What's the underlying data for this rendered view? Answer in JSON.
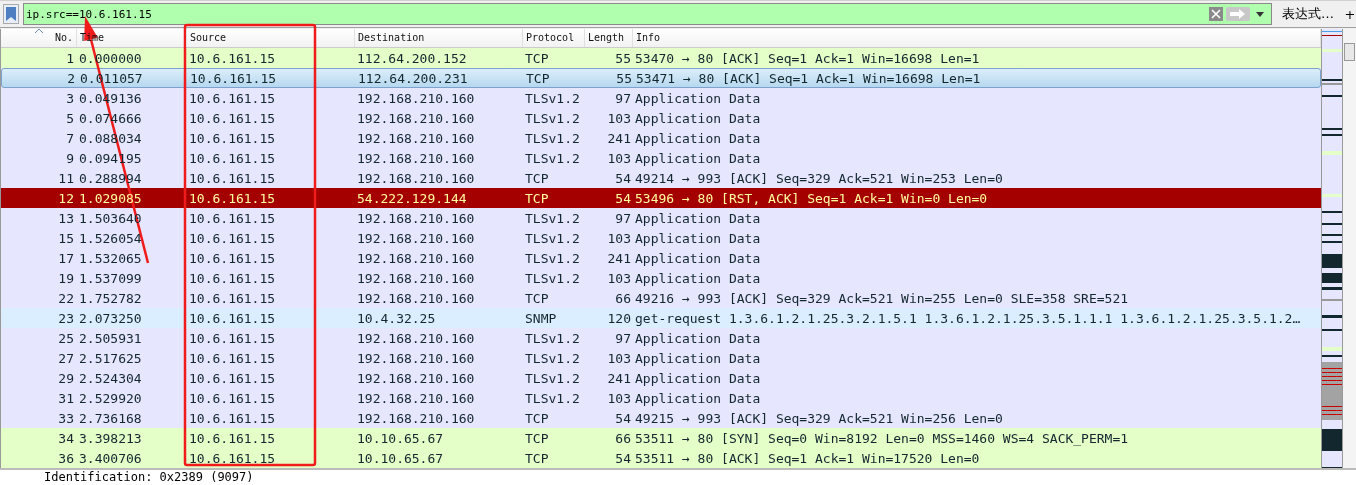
{
  "filter": {
    "value": "ip.src==10.6.161.15",
    "expression_button": "表达式…",
    "add_button": "+"
  },
  "columns": [
    {
      "label": "No.",
      "sorted": true
    },
    {
      "label": "Time",
      "sorted": false
    },
    {
      "label": "Source",
      "sorted": false
    },
    {
      "label": "Destination",
      "sorted": false
    },
    {
      "label": "Protocol",
      "sorted": false
    },
    {
      "label": "Length",
      "sorted": false
    },
    {
      "label": "Info",
      "sorted": false
    }
  ],
  "rows": [
    {
      "no": "1",
      "time": "0.000000",
      "source": "10.6.161.15",
      "destination": "112.64.200.152",
      "protocol": "TCP",
      "length": "55",
      "info": "53470 → 80 [ACK] Seq=1 Ack=1 Win=16698 Len=1",
      "color": "#e4ffc7",
      "selected": false
    },
    {
      "no": "2",
      "time": "0.011057",
      "source": "10.6.161.15",
      "destination": "112.64.200.231",
      "protocol": "TCP",
      "length": "55",
      "info": "53471 → 80 [ACK] Seq=1 Ack=1 Win=16698 Len=1",
      "selected": true
    },
    {
      "no": "3",
      "time": "0.049136",
      "source": "10.6.161.15",
      "destination": "192.168.210.160",
      "protocol": "TLSv1.2",
      "length": "97",
      "info": "Application Data",
      "color": "#e7e6ff",
      "selected": false
    },
    {
      "no": "5",
      "time": "0.074666",
      "source": "10.6.161.15",
      "destination": "192.168.210.160",
      "protocol": "TLSv1.2",
      "length": "103",
      "info": "Application Data",
      "color": "#e7e6ff",
      "selected": false
    },
    {
      "no": "7",
      "time": "0.088034",
      "source": "10.6.161.15",
      "destination": "192.168.210.160",
      "protocol": "TLSv1.2",
      "length": "241",
      "info": "Application Data",
      "color": "#e7e6ff",
      "selected": false
    },
    {
      "no": "9",
      "time": "0.094195",
      "source": "10.6.161.15",
      "destination": "192.168.210.160",
      "protocol": "TLSv1.2",
      "length": "103",
      "info": "Application Data",
      "color": "#e7e6ff",
      "selected": false
    },
    {
      "no": "11",
      "time": "0.288994",
      "source": "10.6.161.15",
      "destination": "192.168.210.160",
      "protocol": "TCP",
      "length": "54",
      "info": "49214 → 993 [ACK] Seq=329 Ack=521 Win=253 Len=0",
      "color": "#e7e6ff",
      "selected": false
    },
    {
      "no": "12",
      "time": "1.029085",
      "source": "10.6.161.15",
      "destination": "54.222.129.144",
      "protocol": "TCP",
      "length": "54",
      "info": "53496 → 80 [RST, ACK] Seq=1 Ack=1 Win=0 Len=0",
      "color": "#a40000",
      "selected": false
    },
    {
      "no": "13",
      "time": "1.503640",
      "source": "10.6.161.15",
      "destination": "192.168.210.160",
      "protocol": "TLSv1.2",
      "length": "97",
      "info": "Application Data",
      "color": "#e7e6ff",
      "selected": false
    },
    {
      "no": "15",
      "time": "1.526054",
      "source": "10.6.161.15",
      "destination": "192.168.210.160",
      "protocol": "TLSv1.2",
      "length": "103",
      "info": "Application Data",
      "color": "#e7e6ff",
      "selected": false
    },
    {
      "no": "17",
      "time": "1.532065",
      "source": "10.6.161.15",
      "destination": "192.168.210.160",
      "protocol": "TLSv1.2",
      "length": "241",
      "info": "Application Data",
      "color": "#e7e6ff",
      "selected": false
    },
    {
      "no": "19",
      "time": "1.537099",
      "source": "10.6.161.15",
      "destination": "192.168.210.160",
      "protocol": "TLSv1.2",
      "length": "103",
      "info": "Application Data",
      "color": "#e7e6ff",
      "selected": false
    },
    {
      "no": "22",
      "time": "1.752782",
      "source": "10.6.161.15",
      "destination": "192.168.210.160",
      "protocol": "TCP",
      "length": "66",
      "info": "49216 → 993 [ACK] Seq=329 Ack=521 Win=255 Len=0 SLE=358 SRE=521",
      "color": "#e7e6ff",
      "selected": false
    },
    {
      "no": "23",
      "time": "2.073250",
      "source": "10.6.161.15",
      "destination": "10.4.32.25",
      "protocol": "SNMP",
      "length": "120",
      "info": "get-request 1.3.6.1.2.1.25.3.2.1.5.1 1.3.6.1.2.1.25.3.5.1.1.1 1.3.6.1.2.1.25.3.5.1.2…",
      "color": "#daeeff",
      "selected": false
    },
    {
      "no": "25",
      "time": "2.505931",
      "source": "10.6.161.15",
      "destination": "192.168.210.160",
      "protocol": "TLSv1.2",
      "length": "97",
      "info": "Application Data",
      "color": "#e7e6ff",
      "selected": false
    },
    {
      "no": "27",
      "time": "2.517625",
      "source": "10.6.161.15",
      "destination": "192.168.210.160",
      "protocol": "TLSv1.2",
      "length": "103",
      "info": "Application Data",
      "color": "#e7e6ff",
      "selected": false
    },
    {
      "no": "29",
      "time": "2.524304",
      "source": "10.6.161.15",
      "destination": "192.168.210.160",
      "protocol": "TLSv1.2",
      "length": "241",
      "info": "Application Data",
      "color": "#e7e6ff",
      "selected": false
    },
    {
      "no": "31",
      "time": "2.529920",
      "source": "10.6.161.15",
      "destination": "192.168.210.160",
      "protocol": "TLSv1.2",
      "length": "103",
      "info": "Application Data",
      "color": "#e7e6ff",
      "selected": false
    },
    {
      "no": "33",
      "time": "2.736168",
      "source": "10.6.161.15",
      "destination": "192.168.210.160",
      "protocol": "TCP",
      "length": "54",
      "info": "49215 → 993 [ACK] Seq=329 Ack=521 Win=256 Len=0",
      "color": "#e7e6ff",
      "selected": false
    },
    {
      "no": "34",
      "time": "3.398213",
      "source": "10.6.161.15",
      "destination": "10.10.65.67",
      "protocol": "TCP",
      "length": "66",
      "info": "53511 → 80 [SYN] Seq=0 Win=8192 Len=0 MSS=1460 WS=4 SACK_PERM=1",
      "color": "#e4ffc7",
      "selected": false
    },
    {
      "no": "36",
      "time": "3.400706",
      "source": "10.6.161.15",
      "destination": "10.10.65.67",
      "protocol": "TCP",
      "length": "54",
      "info": "53511 → 80 [ACK] Seq=1 Ack=1 Win=17520 Len=0",
      "color": "#e4ffc7",
      "selected": false
    }
  ],
  "details": {
    "line": "Identification: 0x2389 (9097)"
  },
  "annotations": [
    {
      "kind": "rectangle"
    },
    {
      "kind": "arrow"
    }
  ]
}
